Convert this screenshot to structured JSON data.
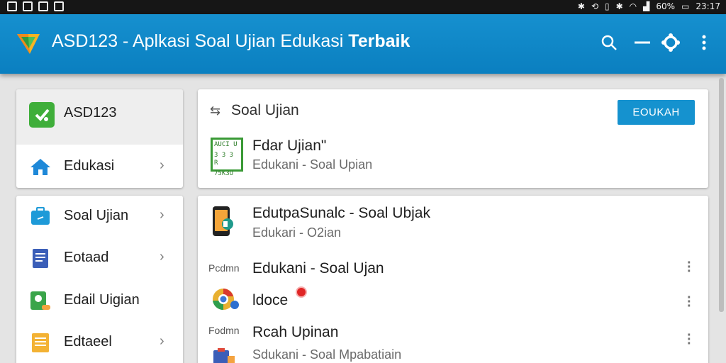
{
  "status_bar": {
    "battery": "60%",
    "time": "23:17"
  },
  "app_bar": {
    "title": "ASD123 - Aplkasi Soal Ujian Edukasi",
    "title_bold": "Terbaik",
    "icons": [
      "search-icon",
      "minimize-icon",
      "settings-icon",
      "more-vertical-icon"
    ]
  },
  "nav": {
    "header_title": "ASD123",
    "home_item": "Edukasi",
    "items": [
      {
        "label": "Soal Ujian",
        "icon": "briefcase-icon",
        "chevron": true
      },
      {
        "label": "Eotaad",
        "icon": "document-icon",
        "chevron": true
      },
      {
        "label": "Edail Uigian",
        "icon": "search-book-icon",
        "chevron": false
      },
      {
        "label": "Edtaeel",
        "icon": "notepad-icon",
        "chevron": true
      }
    ]
  },
  "top_card": {
    "title": "Soal Ujian",
    "button_label": "EOUKAH",
    "item_title": "Fdar Ujian\"",
    "item_subtitle": "Edukani - Soal Upian",
    "qr_text": [
      "AUCI U",
      "3 3 3 R",
      "75K3U"
    ]
  },
  "list": {
    "first": {
      "title": "EdutpaSunalc - Soal Ubjak",
      "subtitle": "Edukari - O2ian"
    },
    "second": {
      "small": "Pcdmn",
      "title": "Edukani - Soal Ujan"
    },
    "third": {
      "title": "ldoce"
    },
    "fourth": {
      "small": "Fodmn",
      "title": "Rcah Upinan",
      "subtitle": "Sdukani - Soal Mpabatiain"
    }
  },
  "colors": {
    "app_bar": "#0a87c8",
    "button": "#1592cf",
    "accent_green": "#3fae3a"
  }
}
